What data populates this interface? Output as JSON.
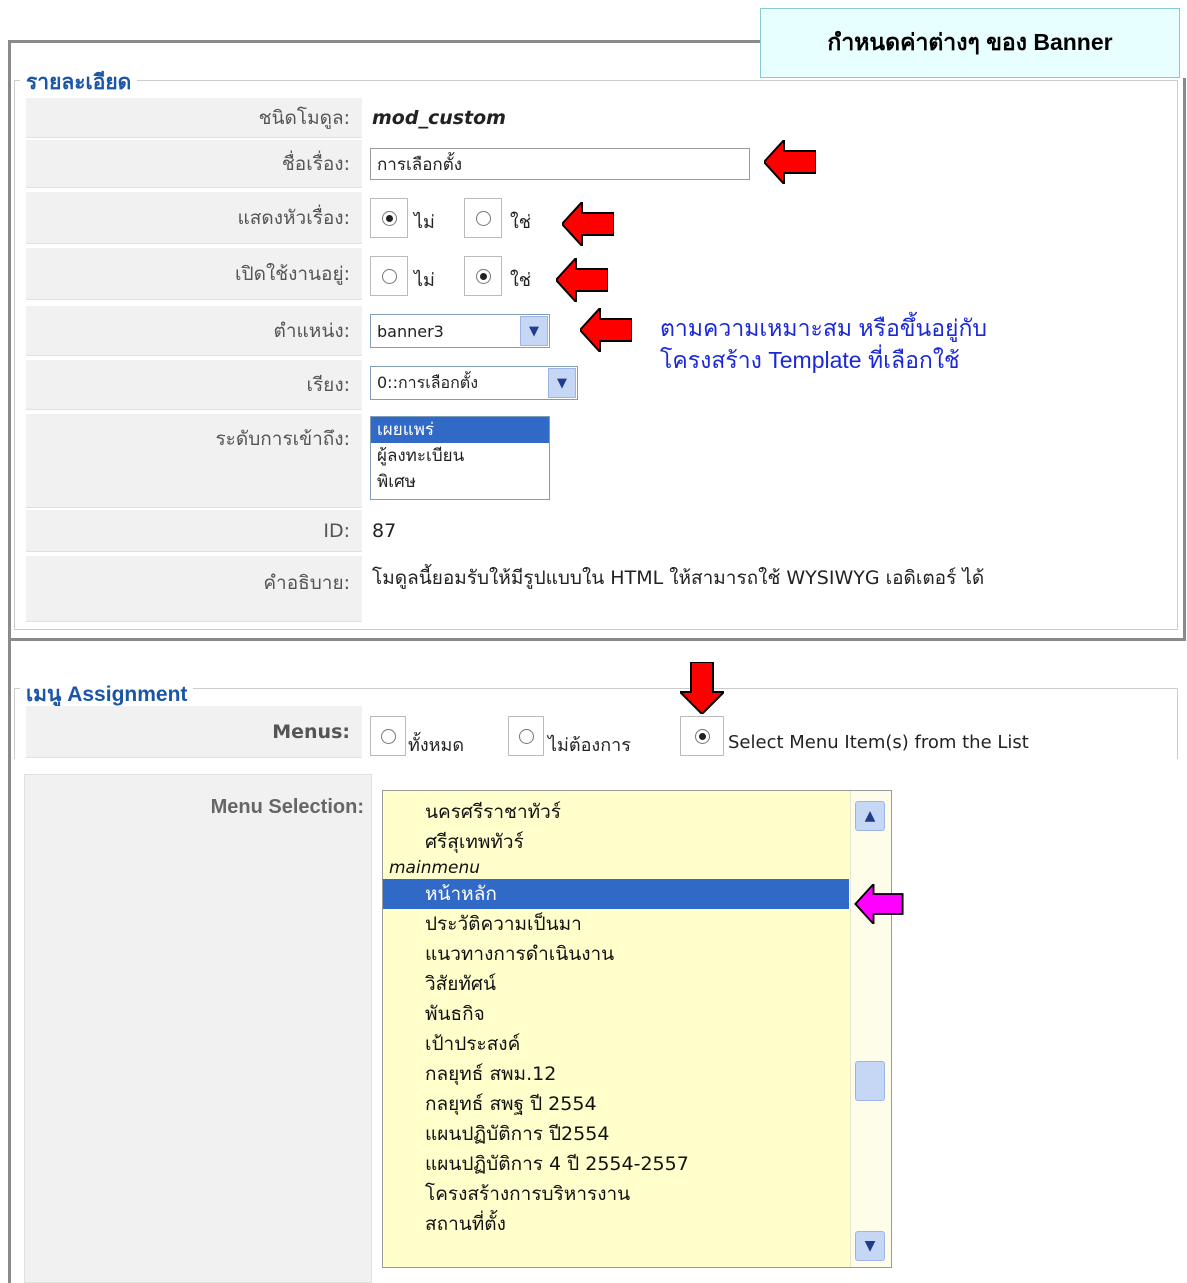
{
  "banner": {
    "title": "กำหนดค่าต่างๆ ของ Banner"
  },
  "details": {
    "legend": "รายละเอียด",
    "module_type": {
      "label": "ชนิดโมดูล:",
      "value": "mod_custom"
    },
    "title": {
      "label": "ชื่อเรื่อง:",
      "value": "การเลือกตั้ง"
    },
    "show_title": {
      "label": "แสดงหัวเรื่อง:",
      "options": [
        "ไม่",
        "ใช่"
      ],
      "selected": "ไม่"
    },
    "enabled": {
      "label": "เปิดใช้งานอยู่:",
      "options": [
        "ไม่",
        "ใช่"
      ],
      "selected": "ใช่"
    },
    "position": {
      "label": "ตำแหน่ง:",
      "value": "banner3"
    },
    "order": {
      "label": "เรียง:",
      "value": "0::การเลือกตั้ง"
    },
    "access": {
      "label": "ระดับการเข้าถึง:",
      "options": [
        "เผยแพร่",
        "ผู้ลงทะเบียน",
        "พิเศษ"
      ],
      "selected": "เผยแพร่"
    },
    "id": {
      "label": "ID:",
      "value": "87"
    },
    "description": {
      "label": "คำอธิบาย:",
      "value": "โมดูลนี้ยอมรับให้มีรูปแบบใน HTML ให้สามารถใช้ WYSIWYG เอดิเตอร์ ได้"
    }
  },
  "note": {
    "line1": "ตามความเหมาะสม หรือขึ้นอยู่กับ",
    "line2": "โครงสร้าง Template ที่เลือกใช้"
  },
  "menu_assignment": {
    "legend": "เมนู Assignment",
    "menus_label": "Menus:",
    "options": [
      "ทั้งหมด",
      "ไม่ต้องการ",
      "Select Menu Item(s) from the List"
    ],
    "selected": "Select Menu Item(s) from the List",
    "selection_label": "Menu Selection:",
    "items": [
      {
        "text": "นครศรีราชาทัวร์",
        "type": "item",
        "selected": false
      },
      {
        "text": "ศรีสุเทพทัวร์",
        "type": "item",
        "selected": false
      },
      {
        "text": "mainmenu",
        "type": "group",
        "selected": false
      },
      {
        "text": "หน้าหลัก",
        "type": "item",
        "selected": true
      },
      {
        "text": "ประวัติความเป็นมา",
        "type": "item",
        "selected": false
      },
      {
        "text": "แนวทางการดำเนินงาน",
        "type": "item",
        "selected": false
      },
      {
        "text": "วิสัยทัศน์",
        "type": "item",
        "selected": false
      },
      {
        "text": "พันธกิจ",
        "type": "item",
        "selected": false
      },
      {
        "text": "เป้าประสงค์",
        "type": "item",
        "selected": false
      },
      {
        "text": "กลยุทธ์ สพม.12",
        "type": "item",
        "selected": false
      },
      {
        "text": "กลยุทธ์ สพฐ ปี 2554",
        "type": "item",
        "selected": false
      },
      {
        "text": "แผนปฏิบัติการ ปี2554",
        "type": "item",
        "selected": false
      },
      {
        "text": "แผนปฏิบัติการ 4 ปี 2554-2557",
        "type": "item",
        "selected": false
      },
      {
        "text": "โครงสร้างการบริหารงาน",
        "type": "item",
        "selected": false
      },
      {
        "text": "สถานที่ตั้ง",
        "type": "item",
        "selected": false
      }
    ]
  },
  "colors": {
    "arrow_red": "#ff0000",
    "arrow_magenta": "#ff00ff",
    "selection": "#3169c6",
    "list_bg": "#ffffcc"
  },
  "icons": {
    "annotation_arrow": "arrow-left-icon",
    "annotation_arrow_down": "arrow-down-icon",
    "dropdown": "chevron-down-icon"
  }
}
